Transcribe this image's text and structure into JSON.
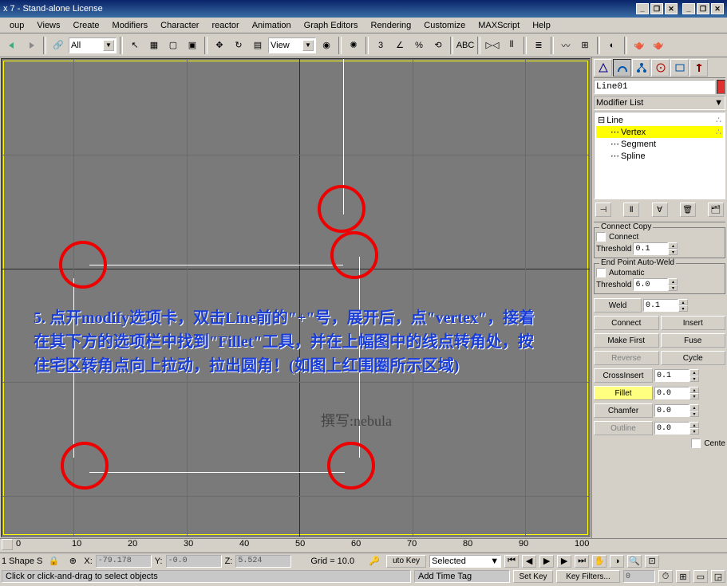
{
  "title": "x 7 - Stand-alone License",
  "menus": [
    "oup",
    "Views",
    "Create",
    "Modifiers",
    "Character",
    "reactor",
    "Animation",
    "Graph Editors",
    "Rendering",
    "Customize",
    "MAXScript",
    "Help"
  ],
  "toolbar": {
    "left_combo": "All",
    "view_combo": "View"
  },
  "right": {
    "object_name": "Line01",
    "modlist": "Modifier List",
    "stack": {
      "root": "Line",
      "subs": [
        "Vertex",
        "Segment",
        "Spline"
      ],
      "active": "Vertex"
    },
    "connect_copy": {
      "title": "Connect Copy",
      "chk": "Connect",
      "thresh_label": "Threshold",
      "thresh": "0.1"
    },
    "autoweld": {
      "title": "End Point Auto-Weld",
      "chk": "Automatic",
      "thresh_label": "Threshold",
      "thresh": "6.0"
    },
    "weld": {
      "label": "Weld",
      "val": "0.1"
    },
    "connect": "Connect",
    "insert": "Insert",
    "makefirst": "Make First",
    "fuse": "Fuse",
    "reverse": "Reverse",
    "cycle": "Cycle",
    "crossins": {
      "label": "CrossInsert",
      "val": "0.1"
    },
    "fillet": {
      "label": "Fillet",
      "val": "0.0"
    },
    "chamfer": {
      "label": "Chamfer",
      "val": "0.0"
    },
    "outline": {
      "label": "Outline",
      "val": "0.0"
    },
    "center": "Cente"
  },
  "ruler": [
    "0",
    "10",
    "20",
    "30",
    "40",
    "50",
    "60",
    "70",
    "80",
    "90",
    "100"
  ],
  "status": {
    "row1_left": "1 Shape S",
    "x": "-79.178",
    "y": "-0.0",
    "z": "5.524",
    "grid": "Grid = 10.0",
    "autokey": "uto Key",
    "selected": "Selected",
    "msg": "Click or click-and-drag to select objects",
    "addtag": "Add Time Tag",
    "setkey": "Set Key",
    "kf": "Key Filters..."
  },
  "annotation": {
    "text": "5. 点开modify选项卡，双击Line前的\"+\"号，展开后，点\"vertex\"，接着在其下方的选项栏中找到\"Fillet\"工具，并在上幅图中的线点转角处，按住宅区转角点向上拉动，拉出圆角！(如图上红围圈所示区域)",
    "credit": "撰写:nebula"
  }
}
